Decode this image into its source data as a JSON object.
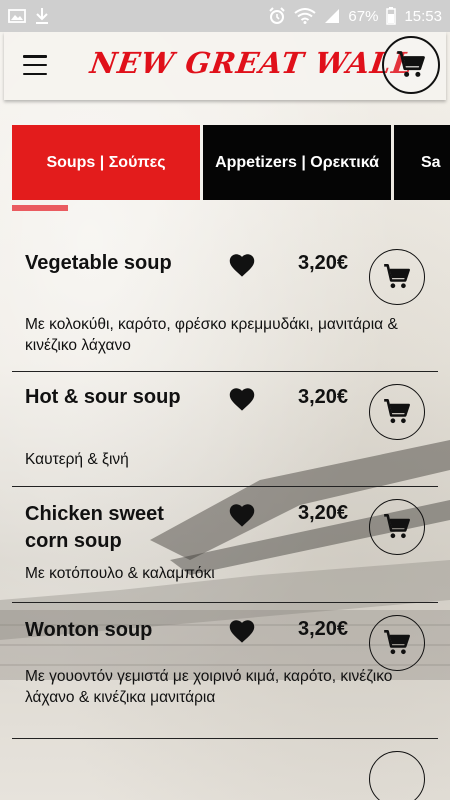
{
  "status_bar": {
    "battery": "67%",
    "time": "15:53"
  },
  "header": {
    "logo": "NEW GREAT WALL",
    "menu_icon": "hamburger-icon",
    "cart_icon": "cart-icon"
  },
  "tabs": [
    {
      "label": "Soups | Σούπες",
      "active": true
    },
    {
      "label": "Appetizers | Ορεκτικά",
      "active": false
    },
    {
      "label": "Sa",
      "active": false
    }
  ],
  "colors": {
    "accent": "#e31c1c",
    "tab_indicator": "#ea5b60",
    "inactive_tab": "#050505"
  },
  "menu_items": [
    {
      "name": "Vegetable soup",
      "price": "3,20€",
      "description": "Με κολοκύθι, καρότο, φρέσκο κρεμμυδάκι, μανιτάρια & κινέζικο λάχανο"
    },
    {
      "name": "Hot & sour soup",
      "price": "3,20€",
      "description": "Καυτερή & ξινή"
    },
    {
      "name_line1": "Chicken sweet",
      "name_line2": "corn soup",
      "price": "3,20€",
      "description": "Με κοτόπουλο & καλαμπόκι"
    },
    {
      "name": "Wonton soup",
      "price": "3,20€",
      "description": "Με γουοντόν γεμιστά με χοιρινό κιμά, καρότο, κινέζικο λάχανο & κινέζικα μανιτάρια"
    }
  ]
}
